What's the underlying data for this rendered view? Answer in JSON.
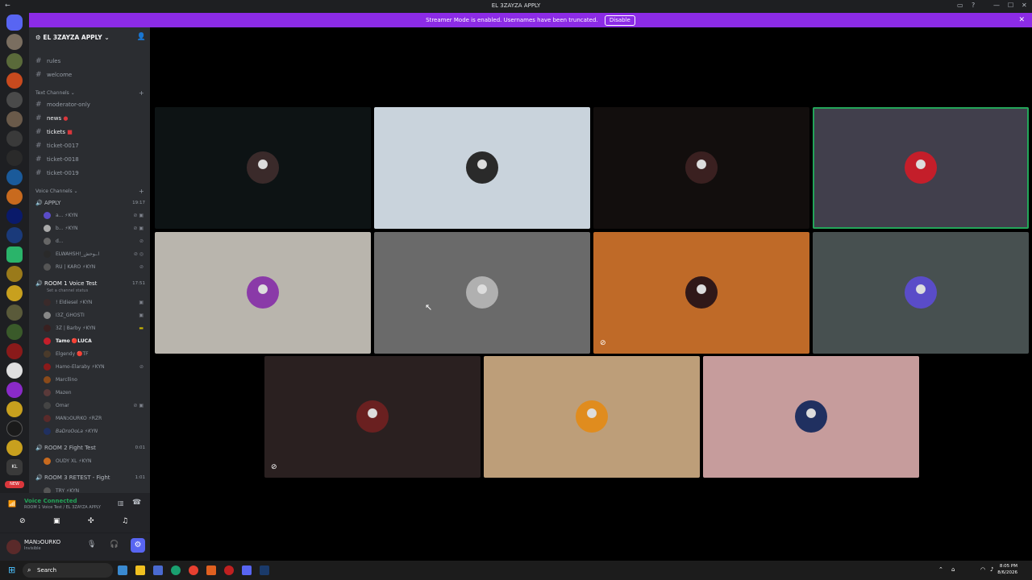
{
  "window": {
    "title": "EL 3ZAYZA APPLY"
  },
  "banner": {
    "text": "Streamer Mode is enabled. Usernames have been truncated.",
    "button": "Disable"
  },
  "guilds": {
    "badge": "NEW",
    "initials": "KL"
  },
  "server": {
    "name": "EL 3ZAYZA APPLY"
  },
  "channels": {
    "top": [
      "rules",
      "welcome"
    ],
    "text_category": "Text Channels",
    "text": [
      {
        "name": "moderator-only",
        "bold": false
      },
      {
        "name": "news",
        "bold": true
      },
      {
        "name": "tickets",
        "bold": true
      },
      {
        "name": "ticket-0017",
        "bold": false
      },
      {
        "name": "ticket-0018",
        "bold": false
      },
      {
        "name": "ticket-0019",
        "bold": false
      }
    ],
    "voice_category": "Voice Channels"
  },
  "voice": [
    {
      "name": "APPLY",
      "timer": "19:17",
      "users": [
        "a... ⚡KYN",
        "b... ⚡KYN",
        "d...",
        "ELWAHSH!_ا.ـوحش",
        "RU | KARO ⚡KYN"
      ]
    },
    {
      "name": "ROOM 1 Voice Test",
      "status": "Set a channel status",
      "timer": "17:51",
      "users": [
        "! Eldiesel ⚡KYN",
        "I3Z_GHOSTI",
        "3Z | Barby ⚡KYN",
        "Tamo 🔴LUCA",
        "Elgendy 🔴TF",
        "Hamo-Elaraby ⚡KYN",
        "Marcllino",
        "Mazen",
        "Omar",
        "MANↄOURKO ⚡RZR",
        "BaDroOoLa ⚡KYN"
      ]
    },
    {
      "name": "ROOM 2 Fight Test",
      "timer": "0:01",
      "users": [
        "OUDY XL ⚡KYN"
      ]
    },
    {
      "name": "ROOM 3 RETEST - Fight",
      "timer": "1:01",
      "users": [
        "TRY ⚡KYN"
      ]
    }
  ],
  "voice_connected": {
    "title": "Voice Connected",
    "sub": "ROOM 1 Voice Test / EL 3ZAYZA APPLY"
  },
  "user": {
    "name": "MANↄOURKO",
    "status": "Invisible"
  },
  "tiles": [
    {
      "bg": "#0d1314",
      "ava": "#3a2a2a",
      "muted": false,
      "speaking": false
    },
    {
      "bg": "#c9d3dc",
      "ava": "#2a2a2a",
      "muted": false,
      "speaking": false
    },
    {
      "bg": "#120e0d",
      "ava": "#3a2020",
      "muted": false,
      "speaking": false
    },
    {
      "bg": "#413f4c",
      "ava": "#c41e2a",
      "muted": false,
      "speaking": true
    },
    {
      "bg": "#b9b5ad",
      "ava": "#8a3aa8",
      "muted": false,
      "speaking": false
    },
    {
      "bg": "#6a6a6a",
      "ava": "#b0b0b0",
      "muted": false,
      "speaking": false
    },
    {
      "bg": "#bf6a28",
      "ava": "#301818",
      "muted": true,
      "speaking": false
    },
    {
      "bg": "#475050",
      "ava": "#5a4cc8",
      "muted": false,
      "speaking": false
    },
    {
      "bg": "#2a2020",
      "ava": "#6a2020",
      "muted": true,
      "speaking": false
    },
    {
      "bg": "#bd9e79",
      "ava": "#e08c1e",
      "muted": false,
      "speaking": false
    },
    {
      "bg": "#c69c9c",
      "ava": "#203060",
      "muted": false,
      "speaking": false
    }
  ],
  "taskbar": {
    "search": "Search",
    "time": "8:05 PM",
    "date": "8/6/2026"
  }
}
